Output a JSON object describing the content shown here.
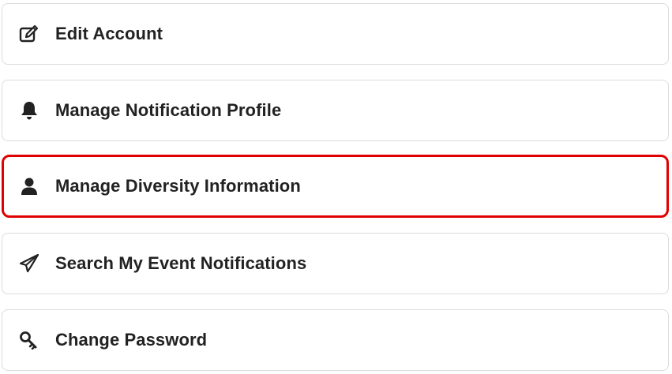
{
  "menu": {
    "items": [
      {
        "label": "Edit Account",
        "icon": "edit-icon"
      },
      {
        "label": "Manage Notification Profile",
        "icon": "bell-icon"
      },
      {
        "label": "Manage Diversity Information",
        "icon": "user-icon",
        "highlighted": true
      },
      {
        "label": "Search My Event Notifications",
        "icon": "paper-plane-icon"
      },
      {
        "label": "Change Password",
        "icon": "key-icon"
      }
    ],
    "highlight_color": "#e00000"
  }
}
